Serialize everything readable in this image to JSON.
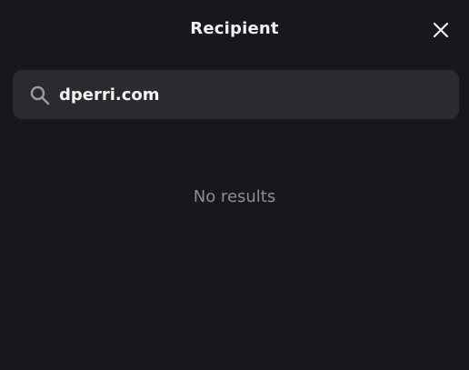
{
  "dialog": {
    "title": "Recipient",
    "close_icon": "close-icon"
  },
  "search": {
    "value": "dperri.com",
    "icon": "search-icon"
  },
  "results": {
    "empty_message": "No results"
  },
  "colors": {
    "background": "#18181c",
    "input_background": "#2b2b2f",
    "text_primary": "#f2f2f4",
    "text_muted": "#8d8d94"
  }
}
